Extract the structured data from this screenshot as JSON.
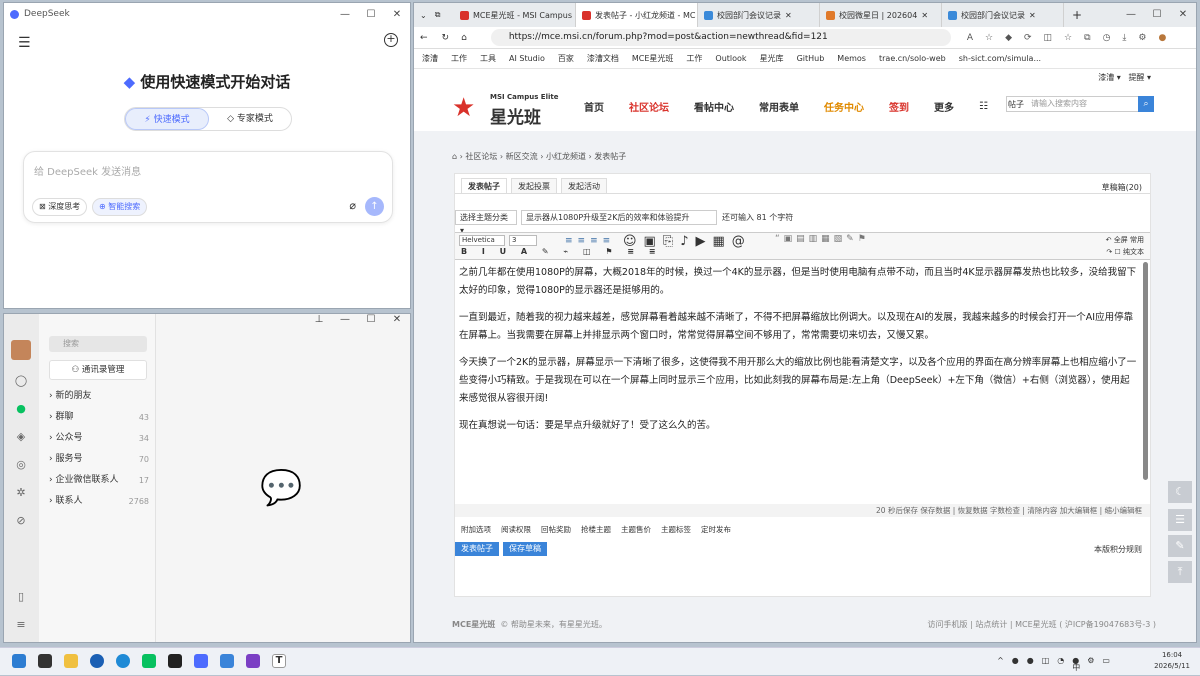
{
  "deepseek": {
    "title": "DeepSeek",
    "welcome": "使用快速模式开始对话",
    "mode_fast": "快速模式",
    "mode_expert": "专家模式",
    "placeholder": "给 DeepSeek 发送消息",
    "deep_think": "深度思考",
    "smart_search": "智能搜索"
  },
  "wechat": {
    "search_placeholder": "搜索",
    "manage_btn": "通讯录管理",
    "items": [
      {
        "label": "新的朋友",
        "count": ""
      },
      {
        "label": "群聊",
        "count": "43"
      },
      {
        "label": "公众号",
        "count": "34"
      },
      {
        "label": "服务号",
        "count": "70"
      },
      {
        "label": "企业微信联系人",
        "count": "17"
      },
      {
        "label": "联系人",
        "count": "2768"
      }
    ]
  },
  "browser": {
    "tabs": [
      {
        "label": "MCE星光班 - MSI Campus Eli",
        "color": "#d9322b"
      },
      {
        "label": "发表帖子 - 小红龙频道 - MC",
        "color": "#d9322b"
      },
      {
        "label": "校园部门会议记录",
        "color": "#3b8ad9"
      },
      {
        "label": "校园微星日 | 202604",
        "color": "#e07a2b"
      },
      {
        "label": "校园部门会议记录",
        "color": "#3b8ad9"
      }
    ],
    "url": "https://mce.msi.cn/forum.php?mod=post&action=newthread&fid=121",
    "bookmarks": [
      "漆漕",
      "工作",
      "工具",
      "AI Studio",
      "百家",
      "漆漕文档",
      "MCE星光班",
      "工作",
      "Outlook",
      "星光库",
      "GitHub",
      "Memos",
      "trae.cn/solo-web",
      "sh-sict.com/simula..."
    ],
    "user": "漆漕",
    "notify": "提醒",
    "site": {
      "brand": "星光班",
      "brand_en": "MSI Campus Elite",
      "nav": [
        "首页",
        "社区论坛",
        "看帖中心",
        "常用表单",
        "任务中心",
        "签到",
        "更多"
      ],
      "search_label": "帖子",
      "search_placeholder": "请输入搜索内容",
      "crumbs": "社区论坛  ›  新区交流  ›  小红龙频道  ›  发表帖子",
      "post_tabs": [
        "发表帖子",
        "发起投票",
        "发起活动"
      ],
      "drafts": "草稿箱(20)",
      "topic_cat": "选择主题分类",
      "subject": "显示器从1080P升级至2K后的效率和体验提升",
      "remain": "还可输入 81 个字符",
      "font": "Helvetica",
      "size": "3",
      "fullscreen": "全屏",
      "common": "常用",
      "plain": "纯文本",
      "paragraphs": [
        "之前几年都在使用1080P的屏幕，大概2018年的时候，换过一个4K的显示器，但是当时使用电脑有点带不动，而且当时4K显示器屏幕发热也比较多，没给我留下太好的印象，觉得1080P的显示器还是挺够用的。",
        "一直到最近，随着我的视力越来越差，感觉屏幕看着越来越不清晰了，不得不把屏幕缩放比例调大。以及现在AI的发展，我越来越多的时候会打开一个AI应用停靠在屏幕上。当我需要在屏幕上并排显示两个窗口时，常常觉得屏幕空间不够用了，常常需要切来切去，又慢又累。",
        "今天换了一个2K的显示器，屏幕显示一下清晰了很多，这使得我不用开那么大的缩放比例也能看清楚文字，以及各个应用的界面在高分辨率屏幕上也相应缩小了一些变得小巧精致。于是我现在可以在一个屏幕上同时显示三个应用，比如此刻我的屏幕布局是:左上角（DeepSeek）+左下角（微信）+右侧（浏览器），使用起来感觉很从容很开阔!",
        "现在真想说一句话：要是早点升级就好了！受了这么久的苦。"
      ],
      "status": "20 秒后保存 保存数据 | 恢复数据    字数检查 | 清除内容    加大编辑框 | 缩小编辑框",
      "options": [
        "附加选项",
        "阅读权限",
        "回帖奖励",
        "抢楼主题",
        "主题售价",
        "主题标签",
        "定时发布"
      ],
      "post_btn": "发表帖子",
      "save_btn": "保存草稿",
      "rules": "本版积分规则",
      "footer_brand": "MCE星光班",
      "footer_slogan": "© 帮助星未来，有星星光班。",
      "footer_links": "访问手机版 | 站点统计 | MCE星光班 ( 沪ICP备19047683号-3 )"
    }
  },
  "taskbar": {
    "time": "16:04",
    "date": "2026/5/11",
    "ime": "中"
  }
}
